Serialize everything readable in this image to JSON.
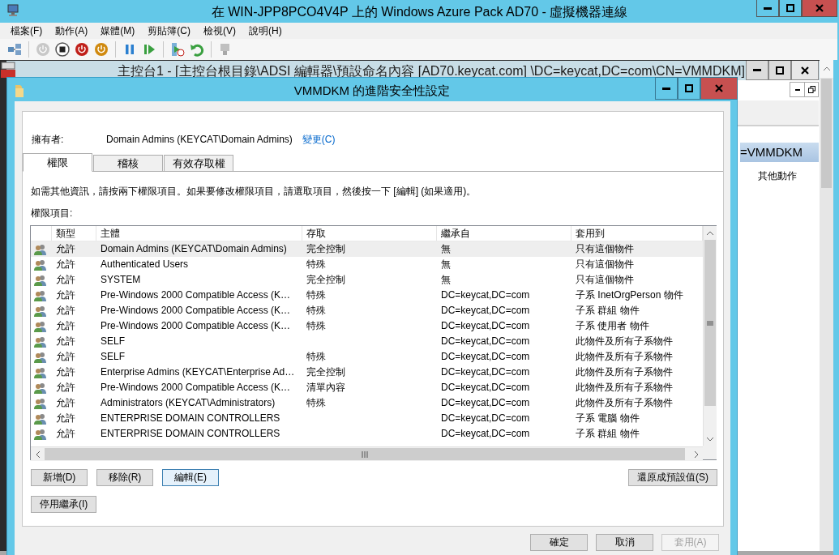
{
  "vm_window": {
    "title": "在 WIN-JPP8PCO4V4P 上的 Windows Azure Pack AD70 - 虛擬機器連線",
    "menu": [
      "檔案(F)",
      "動作(A)",
      "媒體(M)",
      "剪貼簿(C)",
      "檢視(V)",
      "說明(H)"
    ]
  },
  "console": {
    "title": "主控台1 - [主控台根目錄\\ADSI 編輯器\\預設命名內容 [AD70.keycat.com] \\DC=keycat,DC=com\\CN=VMMDKM]"
  },
  "action_pane": {
    "header": "=VMMDKM",
    "items": [
      "其他動作"
    ]
  },
  "dialog": {
    "title": "VMMDKM 的進階安全性設定",
    "owner_label": "擁有者:",
    "owner": "Domain Admins (KEYCAT\\Domain Admins)",
    "change_link": "變更(C)",
    "tabs": [
      {
        "label": "權限",
        "selected": true
      },
      {
        "label": "稽核",
        "selected": false
      },
      {
        "label": "有效存取權",
        "selected": false
      }
    ],
    "instruction": "如需其他資訊，請按兩下權限項目。如果要修改權限項目，請選取項目，然後按一下 [編輯] (如果適用)。",
    "list_label": "權限項目:",
    "table": {
      "columns": [
        "類型",
        "主體",
        "存取",
        "繼承自",
        "套用到"
      ],
      "rows": [
        {
          "type": "允許",
          "principal": "Domain Admins (KEYCAT\\Domain Admins)",
          "access": "完全控制",
          "inherited_from": "無",
          "applies_to": "只有這個物件",
          "selected": true
        },
        {
          "type": "允許",
          "principal": "Authenticated Users",
          "access": "特殊",
          "inherited_from": "無",
          "applies_to": "只有這個物件",
          "selected": false
        },
        {
          "type": "允許",
          "principal": "SYSTEM",
          "access": "完全控制",
          "inherited_from": "無",
          "applies_to": "只有這個物件",
          "selected": false
        },
        {
          "type": "允許",
          "principal": "Pre-Windows 2000 Compatible Access (K…",
          "access": "特殊",
          "inherited_from": "DC=keycat,DC=com",
          "applies_to": "子系 InetOrgPerson 物件",
          "selected": false
        },
        {
          "type": "允許",
          "principal": "Pre-Windows 2000 Compatible Access (K…",
          "access": "特殊",
          "inherited_from": "DC=keycat,DC=com",
          "applies_to": "子系 群組 物件",
          "selected": false
        },
        {
          "type": "允許",
          "principal": "Pre-Windows 2000 Compatible Access (K…",
          "access": "特殊",
          "inherited_from": "DC=keycat,DC=com",
          "applies_to": "子系 使用者 物件",
          "selected": false
        },
        {
          "type": "允許",
          "principal": "SELF",
          "inherited_from": "DC=keycat,DC=com",
          "applies_to": "此物件及所有子系物件",
          "selected": false
        },
        {
          "type": "允許",
          "principal": "SELF",
          "access": "特殊",
          "inherited_from": "DC=keycat,DC=com",
          "applies_to": "此物件及所有子系物件",
          "selected": false
        },
        {
          "type": "允許",
          "principal": "Enterprise Admins (KEYCAT\\Enterprise Ad…",
          "access": "完全控制",
          "inherited_from": "DC=keycat,DC=com",
          "applies_to": "此物件及所有子系物件",
          "selected": false
        },
        {
          "type": "允許",
          "principal": "Pre-Windows 2000 Compatible Access (K…",
          "access": "清單內容",
          "inherited_from": "DC=keycat,DC=com",
          "applies_to": "此物件及所有子系物件",
          "selected": false
        },
        {
          "type": "允許",
          "principal": "Administrators (KEYCAT\\Administrators)",
          "access": "特殊",
          "inherited_from": "DC=keycat,DC=com",
          "applies_to": "此物件及所有子系物件",
          "selected": false
        },
        {
          "type": "允許",
          "principal": "ENTERPRISE DOMAIN CONTROLLERS",
          "inherited_from": "DC=keycat,DC=com",
          "applies_to": "子系 電腦 物件",
          "selected": false
        },
        {
          "type": "允許",
          "principal": "ENTERPRISE DOMAIN CONTROLLERS",
          "inherited_from": "DC=keycat,DC=com",
          "applies_to": "子系 群組 物件",
          "selected": false
        }
      ]
    },
    "buttons": [
      {
        "label": "新增(D)",
        "focused": false
      },
      {
        "label": "移除(R)",
        "focused": false
      },
      {
        "label": "編輯(E)",
        "focused": true
      }
    ],
    "restore_button": "還原成預設值(S)",
    "inheritance_button": "停用繼承(I)",
    "footer_buttons": [
      {
        "label": "確定",
        "disabled": false
      },
      {
        "label": "取消",
        "disabled": false
      },
      {
        "label": "套用(A)",
        "disabled": true
      }
    ]
  }
}
